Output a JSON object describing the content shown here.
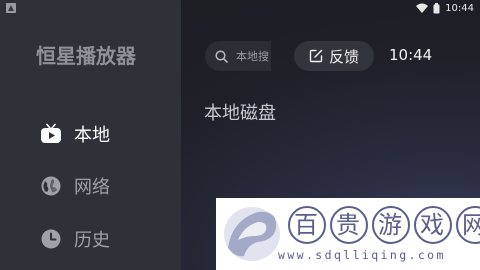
{
  "status_bar": {
    "time": "10:44",
    "left_icon": "notification-icon",
    "wifi_icon": "wifi-icon",
    "battery_icon": "battery-icon"
  },
  "sidebar": {
    "app_title": "恒星播放器",
    "items": [
      {
        "label": "本地",
        "icon": "tv-icon",
        "active": true
      },
      {
        "label": "网络",
        "icon": "globe-icon",
        "active": false
      },
      {
        "label": "历史",
        "icon": "clock-icon",
        "active": false
      }
    ]
  },
  "header": {
    "search_placeholder": "本地搜",
    "feedback_label": "反馈",
    "clock": "10:44"
  },
  "main": {
    "section_title": "本地磁盘"
  },
  "watermark": {
    "chars": [
      "百",
      "贵",
      "游",
      "戏",
      "网"
    ],
    "url": "www.sdqlliqing.com"
  },
  "colors": {
    "sidebar_bg": "#2f3138",
    "main_bg": "#1e1f24",
    "accent": "#ffffff",
    "watermark": "#5a5f8c"
  }
}
